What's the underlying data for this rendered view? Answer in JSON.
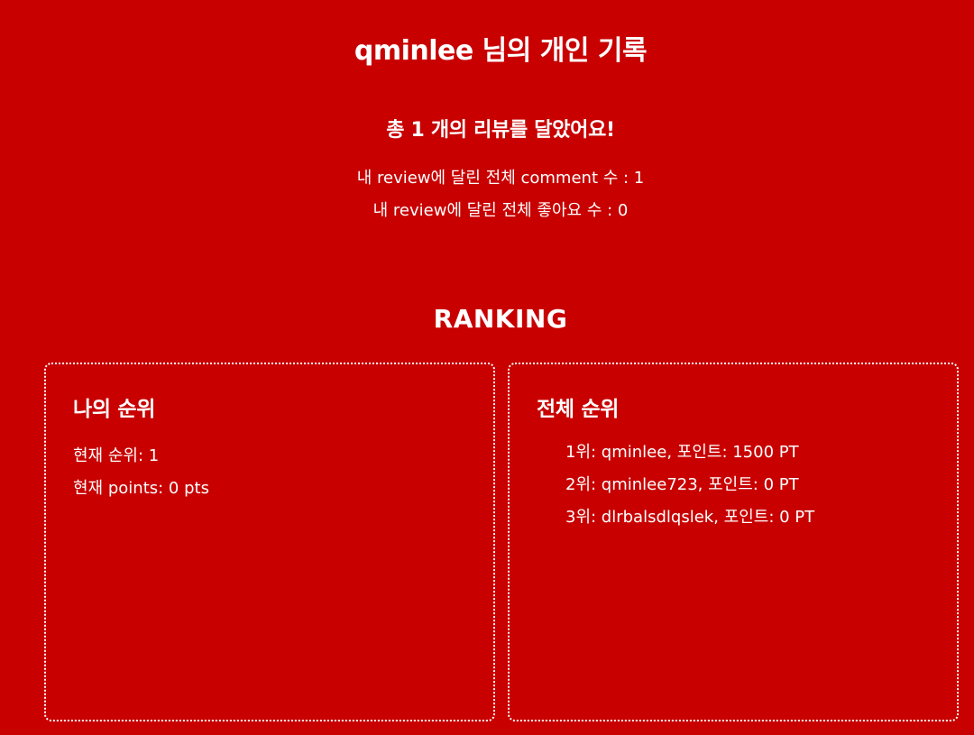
{
  "header": {
    "title": "qminlee 님의 개인 기록"
  },
  "summary": {
    "review_count_text": "총 1 개의 리뷰를 달았어요!",
    "comments_text": "내 review에 달린 전체 comment 수 : 1",
    "likes_text": "내 review에 달린 전체 좋아요 수 : 0"
  },
  "ranking": {
    "heading": "RANKING",
    "my_rank": {
      "title": "나의 순위",
      "current_rank": "현재 순위: 1",
      "current_points": "현재 points: 0 pts"
    },
    "overall": {
      "title": "전체 순위",
      "items": [
        "1위: qminlee, 포인트: 1500 PT",
        "2위: qminlee723, 포인트: 0 PT",
        "3위: dlrbalsdlqslek, 포인트: 0 PT"
      ]
    }
  },
  "colors": {
    "background": "#c80000",
    "text": "#ffffff"
  }
}
